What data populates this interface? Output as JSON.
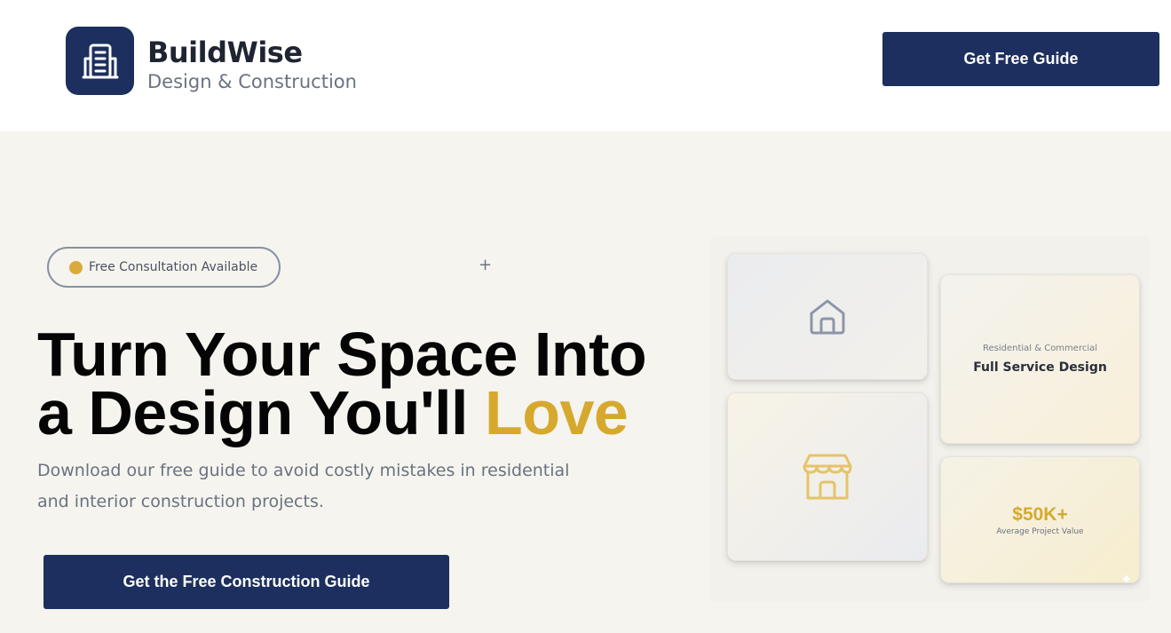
{
  "header": {
    "brand_name": "BuildWise",
    "brand_tagline": "Design & Construction",
    "cta_label": "Get Free Guide"
  },
  "hero": {
    "badge_text": "Free Consultation Available",
    "headline_line1": "Turn Your Space Into",
    "headline_line2_prefix": "a Design You'll ",
    "headline_accent": "Love",
    "subtext": "Download our free guide to avoid costly mistakes in residential and interior construction projects.",
    "cta_label": "Get the Free Construction Guide"
  },
  "cards": {
    "service_kicker": "Residential & Commercial",
    "service_title": "Full Service Design",
    "value_number": "$50K+",
    "value_caption": "Average Project Value"
  },
  "icons": {
    "logo": "building-icon",
    "home": "home-icon",
    "shop": "storefront-icon",
    "plus": "plus-icon",
    "sparkle": "sparkle-icon"
  },
  "colors": {
    "navy": "#1c2f5e",
    "gold": "#d6a92e",
    "hero_bg": "#f5f4ee",
    "muted_text": "#6a7282"
  }
}
